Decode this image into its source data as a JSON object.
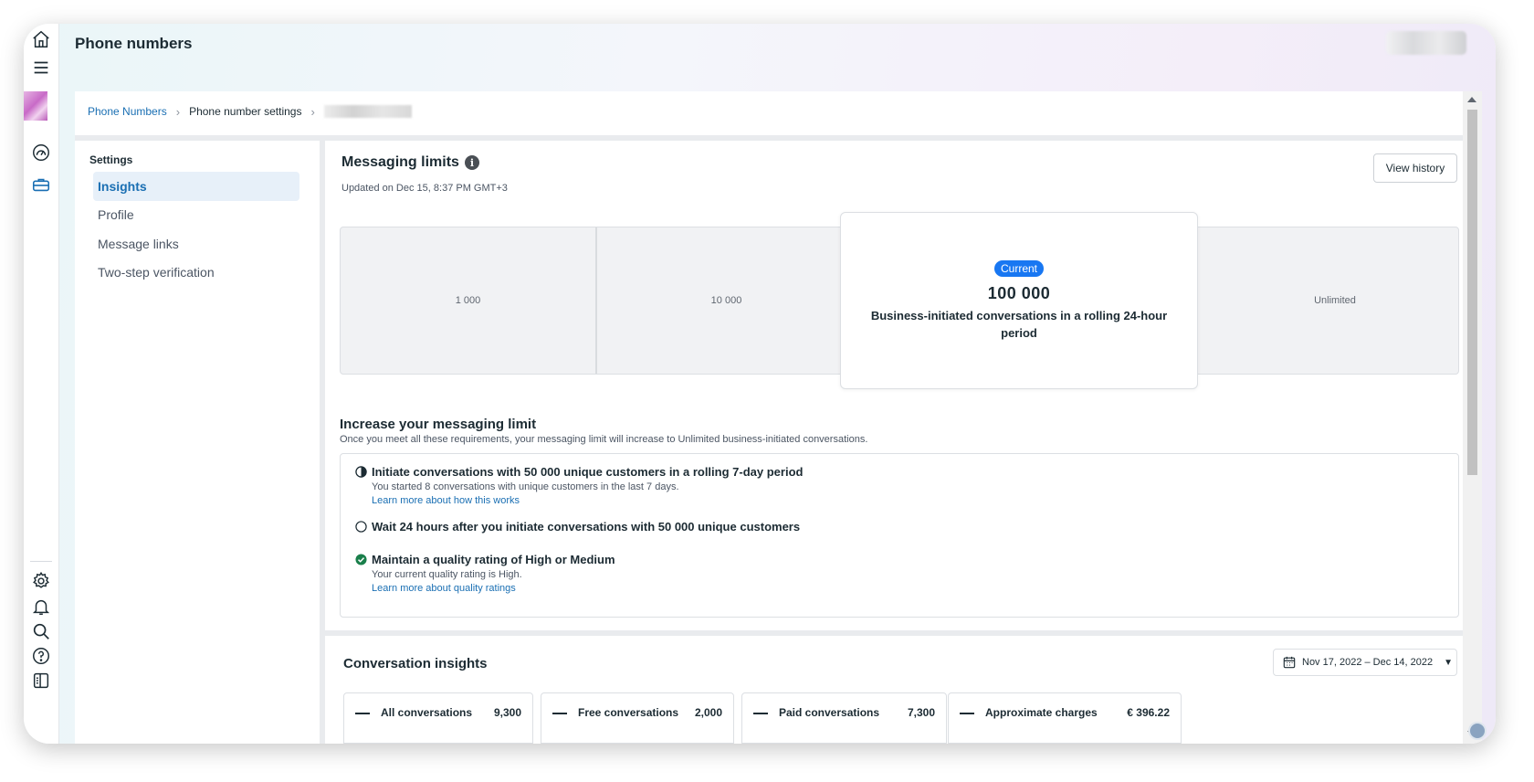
{
  "header": {
    "page_title": "Phone numbers"
  },
  "breadcrumb": {
    "link": "Phone Numbers",
    "current": "Phone number settings"
  },
  "settings": {
    "title": "Settings",
    "items": [
      {
        "label": "Insights",
        "active": true
      },
      {
        "label": "Profile"
      },
      {
        "label": "Message links"
      },
      {
        "label": "Two-step verification"
      }
    ]
  },
  "messaging_limits": {
    "title": "Messaging limits",
    "updated": "Updated on Dec 15, 8:37 PM GMT+3",
    "view_history": "View history",
    "tiers": [
      "1 000",
      "10 000",
      "Unlimited"
    ],
    "current": {
      "badge": "Current",
      "value": "100 000",
      "description": "Business-initiated conversations in a rolling 24-hour period"
    }
  },
  "increase": {
    "title": "Increase your messaging limit",
    "subtitle": "Once you meet all these requirements, your messaging limit will increase to Unlimited business-initiated conversations.",
    "requirements": [
      {
        "status": "in-progress",
        "title": "Initiate conversations with 50 000 unique customers in a rolling 7-day period",
        "text": "You started 8 conversations with unique customers in the last 7 days.",
        "link": "Learn more about how this works"
      },
      {
        "status": "not-started",
        "title": "Wait 24 hours after you initiate conversations with 50 000 unique customers"
      },
      {
        "status": "complete",
        "title": "Maintain a quality rating of High or Medium",
        "text": "Your current quality rating is High.",
        "link": "Learn more about quality ratings"
      }
    ]
  },
  "conversation_insights": {
    "title": "Conversation insights",
    "date_range": "Nov 17, 2022 – Dec 14, 2022",
    "metrics": [
      {
        "label": "All conversations",
        "value": "9,300"
      },
      {
        "label": "Free conversations",
        "value": "2,000"
      },
      {
        "label": "Paid conversations",
        "value": "7,300"
      },
      {
        "label": "Approximate charges",
        "value": "€ 396.22"
      }
    ]
  },
  "colors": {
    "accent": "#1877f2",
    "link": "#1a6fb3",
    "success": "#1a7f4b",
    "text": "#1c2b33"
  }
}
